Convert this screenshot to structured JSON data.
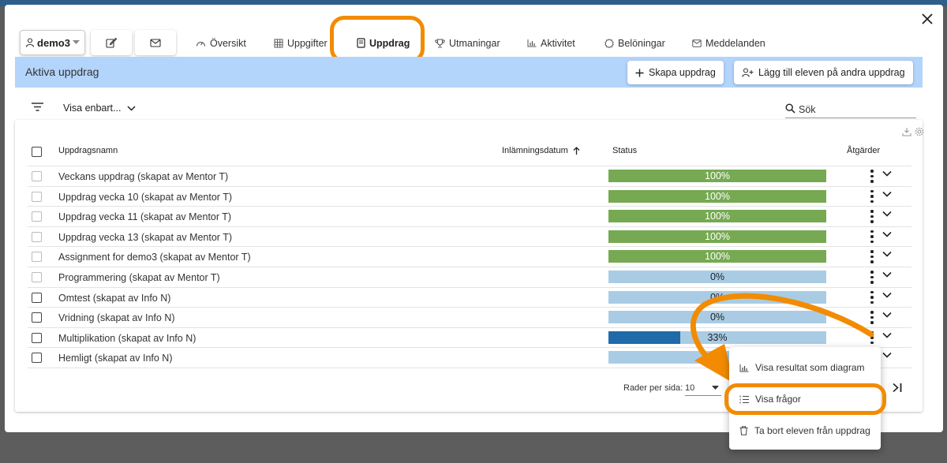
{
  "user": {
    "name": "demo3"
  },
  "tabs": [
    {
      "label": "Översikt",
      "icon": "gauge-icon",
      "active": false
    },
    {
      "label": "Uppgifter",
      "icon": "grid-icon",
      "active": false
    },
    {
      "label": "Uppdrag",
      "icon": "book-icon",
      "active": true
    },
    {
      "label": "Utmaningar",
      "icon": "trophy-icon",
      "active": false
    },
    {
      "label": "Aktivitet",
      "icon": "bar-chart-icon",
      "active": false
    },
    {
      "label": "Belöningar",
      "icon": "badge-icon",
      "active": false
    },
    {
      "label": "Meddelanden",
      "icon": "mail-icon",
      "active": false
    }
  ],
  "section": {
    "title": "Aktiva uppdrag",
    "create_label": "Skapa uppdrag",
    "add_label": "Lägg till eleven på andra uppdrag"
  },
  "filter": {
    "label": "Visa enbart...",
    "search_placeholder": "Sök"
  },
  "table": {
    "headers": {
      "name": "Uppdragsnamn",
      "date": "Inlämningsdatum",
      "status": "Status",
      "actions": "Åtgärder"
    },
    "rows": [
      {
        "name": "Veckans uppdrag (skapat av Mentor T)",
        "progress": 100,
        "status": "100%",
        "checkbox": "light"
      },
      {
        "name": "Uppdrag vecka 10 (skapat av Mentor T)",
        "progress": 100,
        "status": "100%",
        "checkbox": "light"
      },
      {
        "name": "Uppdrag vecka 11 (skapat av Mentor T)",
        "progress": 100,
        "status": "100%",
        "checkbox": "light"
      },
      {
        "name": "Uppdrag vecka 13 (skapat av Mentor T)",
        "progress": 100,
        "status": "100%",
        "checkbox": "light"
      },
      {
        "name": "Assignment for demo3 (skapat av Mentor T)",
        "progress": 100,
        "status": "100%",
        "checkbox": "light"
      },
      {
        "name": "Programmering (skapat av Mentor T)",
        "progress": 0,
        "status": "0%",
        "checkbox": "light"
      },
      {
        "name": "Omtest (skapat av Info N)",
        "progress": 0,
        "status": "0%",
        "checkbox": "dark"
      },
      {
        "name": "Vridning (skapat av Info N)",
        "progress": 0,
        "status": "0%",
        "checkbox": "dark"
      },
      {
        "name": "Multiplikation (skapat av Info N)",
        "progress": 33,
        "status": "33%",
        "checkbox": "dark"
      },
      {
        "name": "Hemligt (skapat av Info N)",
        "progress": 0,
        "status": "0%",
        "checkbox": "dark"
      }
    ],
    "rows_per_page_label": "Rader per sida:",
    "rows_per_page_value": "10"
  },
  "context_menu": {
    "items": [
      {
        "label": "Visa resultat som diagram",
        "icon": "bar-chart-icon"
      },
      {
        "label": "Visa frågor",
        "icon": "list-icon"
      },
      {
        "label": "Ta bort eleven från uppdrag",
        "icon": "trash-icon"
      }
    ]
  },
  "colors": {
    "accent": "#2563a6",
    "highlight": "#f28b00",
    "complete": "#76a952",
    "progress": "#1f6aa8",
    "progress_track": "#a9cce4",
    "section_bar": "#b3d4fb"
  }
}
